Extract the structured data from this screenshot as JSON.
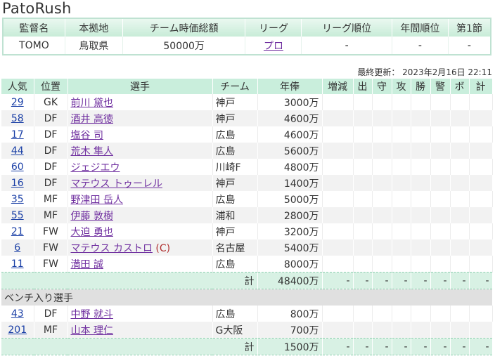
{
  "app": {
    "title": "PatoRush"
  },
  "summary": {
    "headers": [
      "監督名",
      "本拠地",
      "チーム時価総額",
      "リーグ",
      "リーグ順位",
      "年間順位",
      "第1節"
    ],
    "values": {
      "manager": "TOMO",
      "home": "鳥取県",
      "value": "50000万",
      "league": "プロ",
      "league_rank": "-",
      "annual_rank": "-",
      "round1": "-"
    }
  },
  "updated": {
    "label": "最終更新：",
    "datetime": "2023年2月16日 22:11"
  },
  "table": {
    "headers": [
      "人気",
      "位置",
      "選手",
      "チーム",
      "年俸",
      "増減",
      "出",
      "守",
      "攻",
      "勝",
      "警",
      "ボ",
      "計"
    ],
    "starters": [
      {
        "pop": "29",
        "pos": "GK",
        "name": "前川 黛也",
        "team": "神戸",
        "salary": "3000万"
      },
      {
        "pop": "58",
        "pos": "DF",
        "name": "酒井 高徳",
        "team": "神戸",
        "salary": "4600万"
      },
      {
        "pop": "17",
        "pos": "DF",
        "name": "塩谷 司",
        "team": "広島",
        "salary": "4600万"
      },
      {
        "pop": "44",
        "pos": "DF",
        "name": "荒木 隼人",
        "team": "広島",
        "salary": "5600万"
      },
      {
        "pop": "60",
        "pos": "DF",
        "name": "ジェジエウ",
        "team": "川崎F",
        "salary": "4800万"
      },
      {
        "pop": "16",
        "pos": "DF",
        "name": "マテウス トゥーレル",
        "team": "神戸",
        "salary": "1400万"
      },
      {
        "pop": "35",
        "pos": "MF",
        "name": "野津田 岳人",
        "team": "広島",
        "salary": "5000万"
      },
      {
        "pop": "55",
        "pos": "MF",
        "name": "伊藤 敦樹",
        "team": "浦和",
        "salary": "2800万"
      },
      {
        "pop": "21",
        "pos": "FW",
        "name": "大迫 勇也",
        "team": "神戸",
        "salary": "3200万"
      },
      {
        "pop": "6",
        "pos": "FW",
        "name": "マテウス カストロ",
        "captain": "(C)",
        "team": "名古屋",
        "salary": "5400万"
      },
      {
        "pop": "11",
        "pos": "FW",
        "name": "満田 誠",
        "team": "広島",
        "salary": "8000万"
      }
    ],
    "starters_total": {
      "label": "計",
      "salary": "48400万",
      "dashes": [
        "-",
        "-",
        "-",
        "-",
        "-",
        "-",
        "-",
        "-"
      ]
    },
    "bench_header": "ベンチ入り選手",
    "bench": [
      {
        "pop": "43",
        "pos": "DF",
        "name": "中野 就斗",
        "team": "広島",
        "salary": "800万"
      },
      {
        "pop": "201",
        "pos": "MF",
        "name": "山本 理仁",
        "team": "G大阪",
        "salary": "700万"
      }
    ],
    "bench_total": {
      "label": "計",
      "salary": "1500万",
      "dashes": [
        "-",
        "-",
        "-",
        "-",
        "-",
        "-",
        "-",
        "-"
      ]
    }
  }
}
